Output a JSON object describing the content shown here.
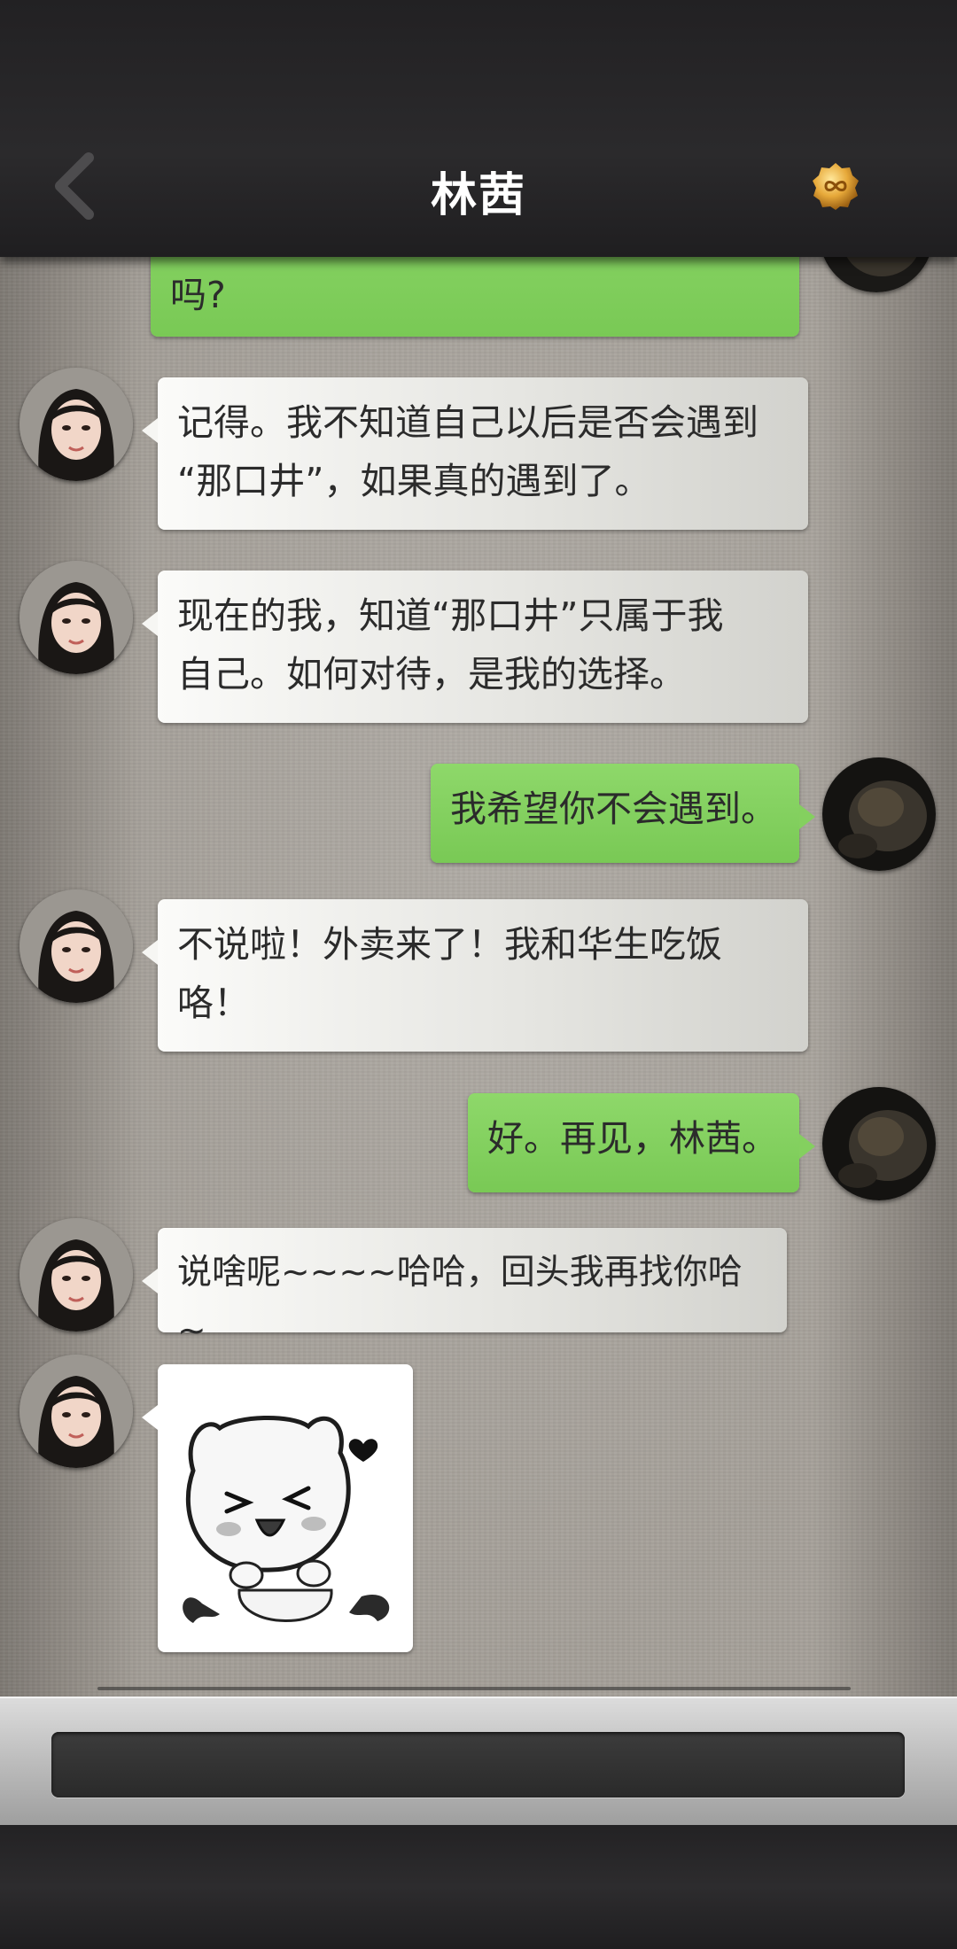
{
  "header": {
    "title": "林茜",
    "back_icon": "chevron-left-icon",
    "badge_icon": "gold-infinity-coin-icon"
  },
  "messages": [
    {
      "side": "out",
      "text": "吗?"
    },
    {
      "side": "in",
      "text": "记得。我不知道自己以后是否会遇到\n“那口井”，如果真的遇到了。"
    },
    {
      "side": "in",
      "text": "现在的我，知道“那口井”只属于我\n自己。如何对待，是我的选择。"
    },
    {
      "side": "out",
      "text": "我希望你不会遇到。"
    },
    {
      "side": "in",
      "text": "不说啦！外卖来了！我和华生吃饭\n咯！"
    },
    {
      "side": "out",
      "text": "好。再见，林茜。"
    },
    {
      "side": "in",
      "text": "说啥呢~~~~哈哈，回头我再找你哈~"
    },
    {
      "side": "in",
      "type": "sticker",
      "sticker": "cat-vampire-laughing-sticker"
    }
  ],
  "input": {
    "placeholder": ""
  },
  "colors": {
    "outgoing_bubble": "#82cf5e",
    "incoming_bubble": "#efefec",
    "header_bg": "#262527"
  }
}
